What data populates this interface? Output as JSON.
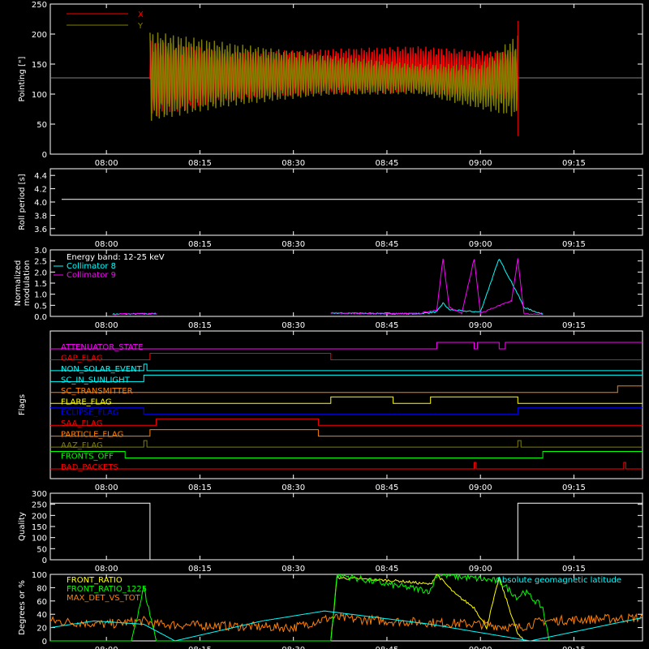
{
  "time_axis": {
    "tick_labels": [
      "08:00",
      "08:15",
      "08:30",
      "08:45",
      "09:00",
      "09:15"
    ],
    "start": "07:51",
    "end": "09:26"
  },
  "chart_data": [
    {
      "id": "pointing",
      "type": "line",
      "ylabel": "Pointing [\"]",
      "ylim": [
        0,
        250
      ],
      "yticks": [
        "0",
        "50",
        "100",
        "150",
        "200",
        "250"
      ],
      "legend": [
        {
          "label": "X",
          "color": "#ff0000"
        },
        {
          "label": "Y",
          "color": "#808000"
        }
      ],
      "series": [
        {
          "name": "X",
          "color": "#ff0000",
          "envelope": {
            "x": [
              "08:07",
              "08:20",
              "08:35",
              "08:50",
              "09:00",
              "09:06"
            ],
            "upper": [
              190,
              170,
              175,
              180,
              172,
              170
            ],
            "lower": [
              60,
              90,
              100,
              102,
              95,
              90
            ]
          }
        },
        {
          "name": "Y",
          "color": "#808000",
          "envelope": {
            "x": [
              "08:07",
              "08:20",
              "08:35",
              "08:50",
              "09:00",
              "09:06"
            ],
            "upper": [
              205,
              185,
              165,
              150,
              150,
              200
            ],
            "lower": [
              55,
              80,
              98,
              100,
              75,
              60
            ]
          }
        }
      ],
      "reference_line": 127,
      "spike": {
        "x": "09:06",
        "ymin": 30,
        "ymax": 222
      },
      "data_range": [
        "08:07",
        "09:06"
      ]
    },
    {
      "id": "roll_period",
      "type": "line",
      "ylabel": "Roll period [s]",
      "ylim": [
        3.5,
        4.5
      ],
      "yticks": [
        "3.6",
        "3.8",
        "4.0",
        "4.2",
        "4.4"
      ],
      "series": [
        {
          "name": "",
          "color": "#ffffff",
          "value": 4.04
        }
      ]
    },
    {
      "id": "modulation",
      "type": "line",
      "ylabel": "Normalized modulation",
      "ylim": [
        0,
        3.0
      ],
      "yticks": [
        "0.0",
        "0.5",
        "1.0",
        "1.5",
        "2.0",
        "2.5",
        "3.0"
      ],
      "legend": [
        {
          "label": "Energy band: 12-25 keV",
          "color": "#ffffff"
        },
        {
          "label": "Collimator 8",
          "color": "#00ffff"
        },
        {
          "label": "Collimator 9",
          "color": "#ff00ff"
        }
      ],
      "series": [
        {
          "name": "Collimator 8",
          "color": "#00ffff",
          "x": [
            "08:01",
            "08:08",
            "08:36",
            "08:50",
            "08:53",
            "08:54",
            "08:55",
            "08:57",
            "09:00",
            "09:03",
            "09:06",
            "09:07",
            "09:10"
          ],
          "values": [
            0.1,
            0.12,
            0.15,
            0.12,
            0.2,
            0.6,
            0.3,
            0.25,
            0.2,
            2.6,
            1.0,
            0.4,
            0.1
          ]
        },
        {
          "name": "Collimator 9",
          "color": "#ff00ff",
          "x": [
            "08:01",
            "08:08",
            "08:36",
            "08:50",
            "08:53",
            "08:54",
            "08:55",
            "08:57",
            "08:59",
            "09:00",
            "09:05",
            "09:06",
            "09:07",
            "09:10"
          ],
          "values": [
            0.1,
            0.12,
            0.15,
            0.12,
            0.3,
            2.6,
            0.4,
            0.15,
            2.6,
            0.15,
            0.7,
            2.6,
            0.1,
            0.1
          ]
        }
      ]
    },
    {
      "id": "flags",
      "type": "line",
      "ylabel": "Flags",
      "series": [
        {
          "name": "ATTENUATOR_STATE",
          "color": "#ff00ff",
          "steps": [
            [
              "07:51",
              0
            ],
            [
              "08:53",
              1
            ],
            [
              "08:59",
              0
            ],
            [
              "08:59.5",
              1
            ],
            [
              "09:03",
              0
            ],
            [
              "09:04",
              1
            ],
            [
              "09:26",
              1
            ]
          ]
        },
        {
          "name": "GAP_FLAG",
          "color": "#ff0000",
          "steps": [
            [
              "07:51",
              0
            ],
            [
              "08:07",
              1
            ],
            [
              "08:36",
              0
            ],
            [
              "09:26",
              0
            ]
          ]
        },
        {
          "name": "NON_SOLAR_EVENT",
          "color": "#00ffff",
          "steps": [
            [
              "07:51",
              0
            ],
            [
              "08:06",
              1
            ],
            [
              "08:06.5",
              0
            ],
            [
              "09:26",
              0
            ]
          ]
        },
        {
          "name": "SC_IN_SUNLIGHT",
          "color": "#00ffff",
          "steps": [
            [
              "07:51",
              0
            ],
            [
              "08:06",
              1
            ],
            [
              "09:26",
              1
            ]
          ]
        },
        {
          "name": "SC_TRANSMITTER",
          "color": "#ff8000",
          "steps": [
            [
              "07:51",
              0
            ],
            [
              "09:22",
              1
            ],
            [
              "09:26",
              1
            ]
          ]
        },
        {
          "name": "FLARE_FLAG",
          "color": "#ffff00",
          "steps": [
            [
              "07:51",
              0
            ],
            [
              "08:36",
              1
            ],
            [
              "08:46",
              0
            ],
            [
              "08:52",
              1
            ],
            [
              "09:06",
              0
            ],
            [
              "09:26",
              0
            ]
          ]
        },
        {
          "name": "ECLIPSE_FLAG",
          "color": "#0000ff",
          "steps": [
            [
              "07:51",
              1
            ],
            [
              "08:06",
              0
            ],
            [
              "09:06",
              1
            ],
            [
              "09:26",
              1
            ]
          ]
        },
        {
          "name": "SAA_FLAG",
          "color": "#ff0000",
          "steps": [
            [
              "07:51",
              0
            ],
            [
              "08:08",
              1
            ],
            [
              "08:34",
              0
            ],
            [
              "09:26",
              0
            ]
          ]
        },
        {
          "name": "PARTICLE_FLAG",
          "color": "#ff8000",
          "steps": [
            [
              "07:51",
              0
            ],
            [
              "08:07",
              1
            ],
            [
              "08:34",
              0
            ],
            [
              "09:26",
              0
            ]
          ]
        },
        {
          "name": "AAZ_FLAG",
          "color": "#808000",
          "steps": [
            [
              "07:51",
              0
            ],
            [
              "08:06",
              1
            ],
            [
              "08:06.5",
              0
            ],
            [
              "09:06",
              1
            ],
            [
              "09:06.5",
              0
            ],
            [
              "09:26",
              0
            ]
          ]
        },
        {
          "name": "FRONTS_OFF",
          "color": "#00ff00",
          "steps": [
            [
              "07:51",
              1
            ],
            [
              "08:03",
              0
            ],
            [
              "09:10",
              1
            ],
            [
              "09:26",
              1
            ]
          ]
        },
        {
          "name": "BAD_PACKETS",
          "color": "#ff0000",
          "steps": [
            [
              "07:51",
              0
            ],
            [
              "08:59",
              1
            ],
            [
              "08:59.3",
              0
            ],
            [
              "09:23",
              1
            ],
            [
              "09:23.3",
              0
            ],
            [
              "09:26",
              0
            ]
          ]
        }
      ]
    },
    {
      "id": "quality",
      "type": "line",
      "ylabel": "Quality",
      "ylim": [
        0,
        300
      ],
      "yticks": [
        "0",
        "50",
        "100",
        "150",
        "200",
        "250",
        "300"
      ],
      "series": [
        {
          "name": "",
          "color": "#ffffff",
          "steps": [
            [
              "07:51",
              255
            ],
            [
              "08:07",
              0
            ],
            [
              "09:06",
              255
            ],
            [
              "09:26",
              255
            ]
          ]
        }
      ]
    },
    {
      "id": "ratios",
      "type": "line",
      "ylabel": "Degrees or %",
      "ylim": [
        0,
        100
      ],
      "yticks": [
        "0",
        "20",
        "40",
        "60",
        "80",
        "100"
      ],
      "legend": [
        {
          "label": "FRONT_RATIO",
          "color": "#ffff00"
        },
        {
          "label": "FRONT_RATIO_1225",
          "color": "#00ff00"
        },
        {
          "label": "MAX_DET_VS_TOT",
          "color": "#ff8000"
        },
        {
          "label": "Absolute geomagnetic latitude",
          "color": "#00ffff"
        }
      ],
      "series": [
        {
          "name": "Absolute geomagnetic latitude",
          "color": "#00ffff",
          "x": [
            "07:51",
            "07:58",
            "08:06",
            "08:11",
            "08:25",
            "08:35",
            "08:52",
            "09:08",
            "09:26"
          ],
          "values": [
            20,
            30,
            25,
            0,
            30,
            45,
            25,
            0,
            35
          ]
        },
        {
          "name": "FRONT_RATIO",
          "color": "#ffff00",
          "x": [
            "08:36",
            "08:37",
            "08:47",
            "08:52",
            "08:53",
            "08:56",
            "08:59",
            "09:01",
            "09:03",
            "09:06",
            "09:07"
          ],
          "values": [
            0,
            95,
            90,
            85,
            100,
            70,
            50,
            20,
            95,
            10,
            0
          ]
        },
        {
          "name": "FRONT_RATIO_1225",
          "color": "#00ff00",
          "x": [
            "07:51",
            "08:04",
            "08:06",
            "08:08",
            "08:36",
            "08:37",
            "08:45",
            "08:52",
            "08:53",
            "09:03",
            "09:06",
            "09:07",
            "09:10",
            "09:11"
          ],
          "values": [
            0,
            0,
            80,
            0,
            0,
            100,
            85,
            75,
            100,
            90,
            65,
            75,
            50,
            0
          ]
        },
        {
          "name": "MAX_DET_VS_TOT",
          "color": "#ff8000",
          "x": [
            "07:51",
            "08:00",
            "08:06",
            "08:08",
            "08:30",
            "08:36",
            "08:45",
            "09:00",
            "09:06",
            "09:10",
            "09:26"
          ],
          "values": [
            30,
            25,
            30,
            25,
            20,
            35,
            30,
            25,
            20,
            30,
            35
          ]
        }
      ]
    }
  ]
}
